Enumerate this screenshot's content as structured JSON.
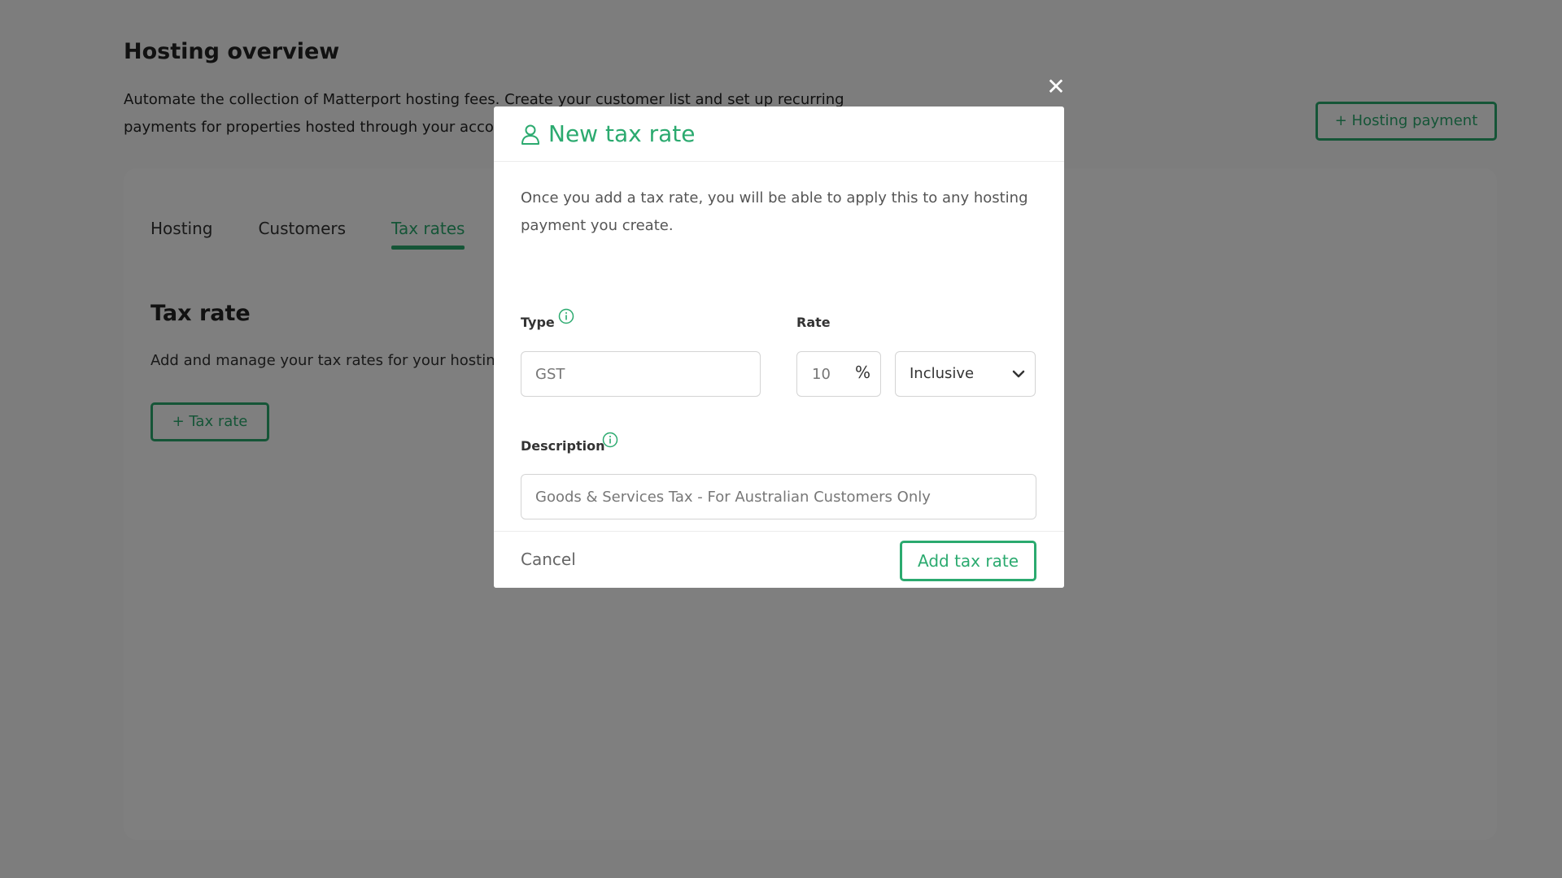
{
  "page": {
    "title": "Hosting overview",
    "description": "Automate the collection of Matterport hosting fees. Create your customer list and set up recurring payments for properties hosted through your account.",
    "hosting_payment_button": "+ Hosting payment"
  },
  "tabs": [
    {
      "label": "Hosting"
    },
    {
      "label": "Customers"
    },
    {
      "label": "Tax rates"
    }
  ],
  "section": {
    "title": "Tax rate",
    "description": "Add and manage your tax rates for your hosting payments.",
    "add_button": "+  Tax rate"
  },
  "modal": {
    "close_label": "✕",
    "title": "New tax rate",
    "intro": "Once you add a tax rate, you will be able to apply this to any hosting payment you create.",
    "type_label": "Type",
    "type_placeholder": "GST",
    "rate_label": "Rate",
    "rate_placeholder": "10",
    "rate_unit": "%",
    "rate_mode": "Inclusive",
    "description_label": "Description",
    "description_placeholder": "Goods & Services Tax - For Australian Customers Only",
    "cancel_label": "Cancel",
    "submit_label": "Add tax rate"
  },
  "colors": {
    "accent": "#2baa6f",
    "overlay": "rgba(0,0,0,0.5)"
  },
  "icons": {
    "header": "user-icon",
    "info": "info-icon",
    "dropdown": "chevron-down-icon",
    "close": "close-icon"
  }
}
